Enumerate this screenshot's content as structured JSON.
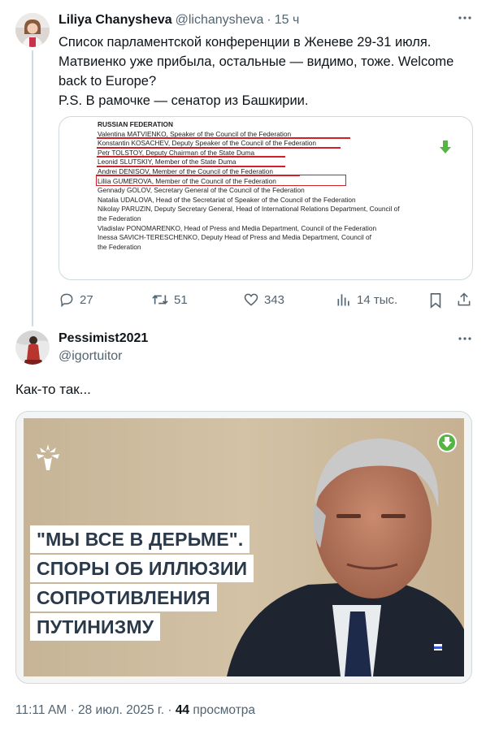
{
  "tweet1": {
    "author_name": "Liliya Chanysheva",
    "handle": "@lichanysheva",
    "separator": "·",
    "time": "15 ч",
    "text_lines": [
      "Список парламентской конференции в Женеве 29-31 июля.",
      "Матвиенко уже прибыла, остальные — видимо, тоже. Welcome",
      "back to Europe?",
      "P.S. В рамочке — сенатор из Башкирии."
    ],
    "document": {
      "heading": "RUSSIAN FEDERATION",
      "lines": [
        "Valentina MATVIENKO, Speaker of the Council of the Federation",
        "Konstantin KOSACHEV, Deputy Speaker of the Council of the Federation",
        "Petr TOLSTOY, Deputy Chairman of the State Duma",
        "Leonid SLUTSKIY, Member of the State Duma",
        "Andrei DENISOV, Member of the Council of the Federation",
        "Liliia GUMEROVA, Member of the Council of the Federation",
        "Gennady GOLOV, Secretary General of the Council of the Federation",
        "Natalia UDALOVA, Head of the Secretariat of Speaker of the Council of the Federation",
        "Nikolay PARUZIN, Deputy Secretary General, Head of International Relations Department, Council of",
        "the Federation",
        "Vladislav PONOMARENKO, Head of Press and Media Department, Council of the Federation",
        "Inessa SAVICH-TERESCHENKO, Deputy Head of Press and Media Department, Council of",
        "the Federation"
      ]
    },
    "actions": {
      "replies": "27",
      "reposts": "51",
      "likes": "343",
      "views": "14 тыс."
    }
  },
  "tweet2": {
    "author_name": "Pessimist2021",
    "handle": "@igortuitor",
    "text": "Как-то так...",
    "image_quote_lines": [
      "\"МЫ ВСЕ В ДЕРЬМЕ\".",
      "СПОРЫ ОБ ИЛЛЮЗИИ",
      "СОПРОТИВЛЕНИЯ",
      "ПУТИНИЗМУ"
    ],
    "meta": {
      "time": "11:11 AM",
      "dot": "·",
      "date": "28 июл. 2025 г.",
      "views_count": "44",
      "views_label": "просмотра"
    }
  },
  "colors": {
    "text": "#0f1419",
    "secondary": "#536471",
    "border": "#cfd9de",
    "highlight_red": "#d0202a",
    "download_green": "#55b543"
  }
}
